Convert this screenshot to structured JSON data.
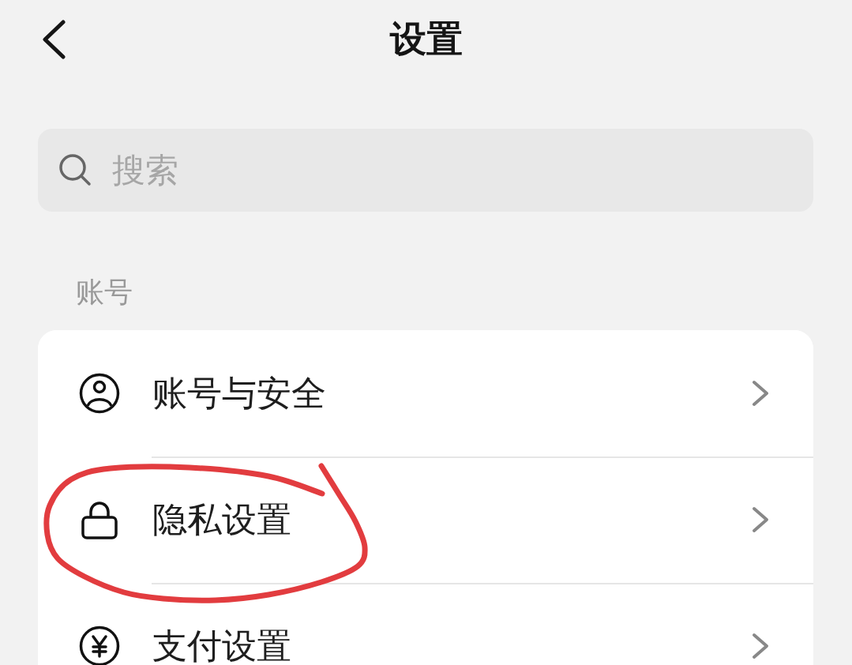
{
  "header": {
    "title": "设置"
  },
  "search": {
    "placeholder": "搜索"
  },
  "sections": [
    {
      "label": "账号",
      "items": [
        {
          "kind": "account",
          "label": "账号与安全",
          "circled": false
        },
        {
          "kind": "lock",
          "label": "隐私设置",
          "circled": true
        },
        {
          "kind": "payment",
          "label": "支付设置",
          "circled": false
        }
      ]
    }
  ]
}
